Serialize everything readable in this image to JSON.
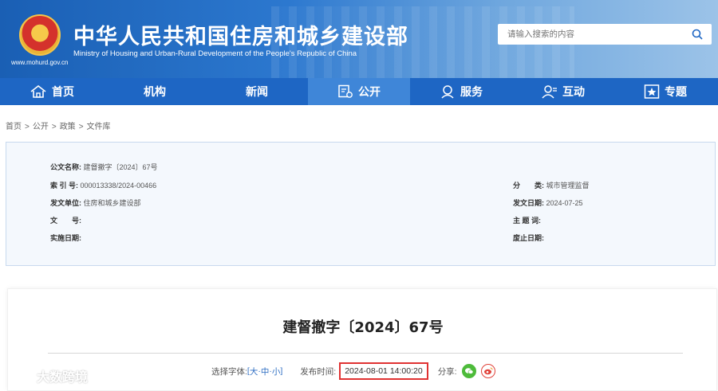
{
  "header": {
    "domain": "www.mohurd.gov.cn",
    "title": "中华人民共和国住房和城乡建设部",
    "subtitle": "Ministry of Housing and Urban-Rural Development of the People's Republic of China",
    "search_placeholder": "请输入搜索的内容",
    "emblem_icon": "national-emblem-icon",
    "search_icon": "search-icon"
  },
  "nav": {
    "items": [
      {
        "label": "首页",
        "icon": "home-icon"
      },
      {
        "label": "机构",
        "icon": ""
      },
      {
        "label": "新闻",
        "icon": ""
      },
      {
        "label": "公开",
        "icon": "document-icon",
        "active": true
      },
      {
        "label": "服务",
        "icon": "service-icon"
      },
      {
        "label": "互动",
        "icon": "interact-icon"
      },
      {
        "label": "专题",
        "icon": "star-icon"
      }
    ]
  },
  "breadcrumb": {
    "items": [
      "首页",
      "公开",
      "政策",
      "文件库"
    ],
    "separator": ">"
  },
  "meta": {
    "doc_name_label": "公文名称:",
    "doc_name": "建督撤字〔2024〕67号",
    "index_label": "索 引 号:",
    "index": "000013338/2024-00466",
    "category_label": "分　　类:",
    "category": "城市管理监督",
    "issuer_label": "发文单位:",
    "issuer": "住房和城乡建设部",
    "issue_date_label": "发文日期:",
    "issue_date": "2024-07-25",
    "doc_no_label": "文　　号:",
    "doc_no": "",
    "subject_label": "主 题 词:",
    "subject": "",
    "effective_label": "实施日期:",
    "effective": "",
    "expiry_label": "废止日期:",
    "expiry": ""
  },
  "document": {
    "title": "建督撤字〔2024〕67号",
    "font_select_label": "选择字体:",
    "font_sizes": [
      "大",
      "中",
      "小"
    ],
    "publish_label": "发布时间:",
    "publish_time": "2024-08-01 14:00:20",
    "share_label": "分享:",
    "share_icons": [
      "wechat-icon",
      "weibo-icon"
    ]
  },
  "watermark": {
    "text": "大数跨境"
  },
  "colors": {
    "nav_bg": "#1e66c4",
    "nav_active": "#3f86d8",
    "highlight_border": "#e03232",
    "meta_bg": "#f4f8fd"
  }
}
